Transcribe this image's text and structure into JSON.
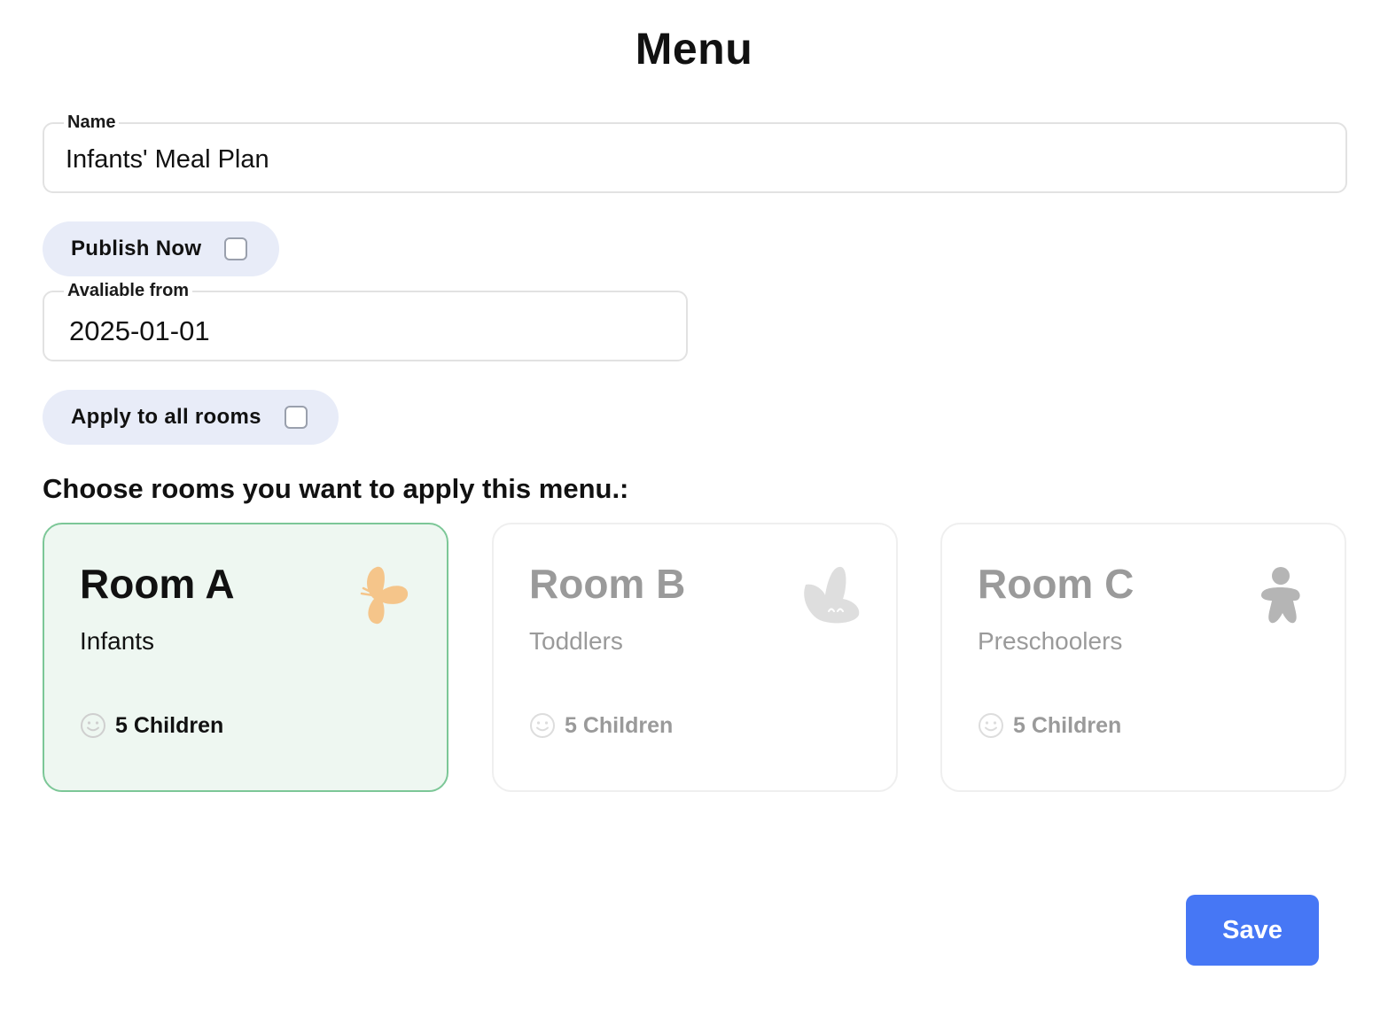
{
  "page": {
    "title": "Menu"
  },
  "name_field": {
    "label": "Name",
    "value": "Infants' Meal Plan"
  },
  "publish_now": {
    "label": "Publish Now",
    "checked": false
  },
  "available_from": {
    "label": "Avaliable from",
    "value": "2025-01-01"
  },
  "apply_all_rooms": {
    "label": "Apply to all rooms",
    "checked": false
  },
  "rooms_section": {
    "heading": "Choose rooms you want to apply this menu.:",
    "rooms": [
      {
        "name": "Room A",
        "group": "Infants",
        "children": "5 Children",
        "selected": true,
        "icon": "butterfly-icon",
        "icon_color": "#f5c58a"
      },
      {
        "name": "Room B",
        "group": "Toddlers",
        "children": "5 Children",
        "selected": false,
        "icon": "bunny-icon",
        "icon_color": "#dedede"
      },
      {
        "name": "Room C",
        "group": "Preschoolers",
        "children": "5 Children",
        "selected": false,
        "icon": "child-figure-icon",
        "icon_color": "#b5b5b5"
      }
    ]
  },
  "actions": {
    "save_label": "Save"
  },
  "colors": {
    "accent": "#4677f5",
    "selected_border": "#7cc797",
    "selected_background": "#eef7f1",
    "pill_background": "#e8ecf8"
  }
}
